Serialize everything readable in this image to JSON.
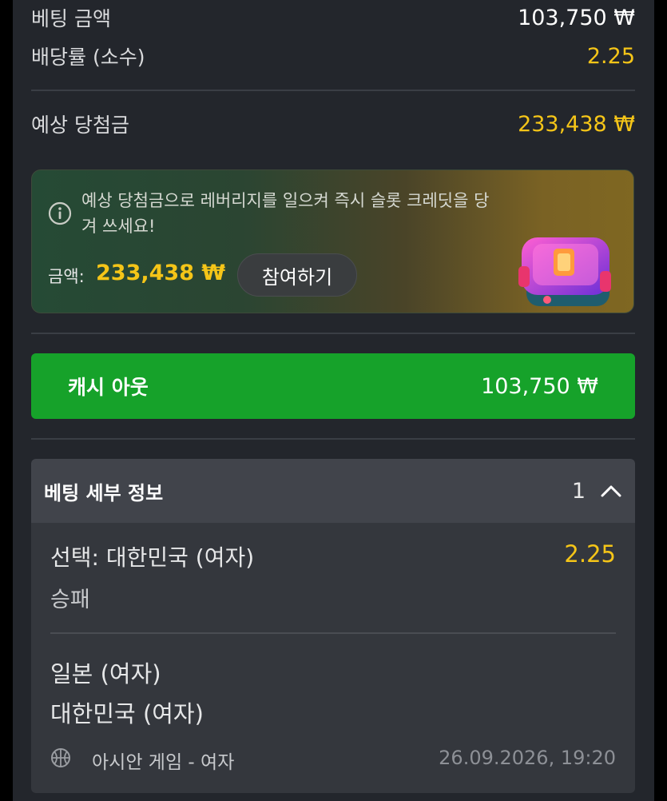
{
  "bet_summary": {
    "stake_label": "베팅 금액",
    "stake_value": "103,750 ₩",
    "odds_label": "배당률 (소수)",
    "odds_value": "2.25",
    "payout_label": "예상 당첨금",
    "payout_value": "233,438 ₩"
  },
  "promo": {
    "message": "예상 당첨금으로 레버리지를 일으켜 즉시 슬롯 크레딧을 당겨 쓰세요!",
    "amount_label": "금액:",
    "amount_value": "233,438 ₩",
    "join_label": "참여하기",
    "icon": "info-icon"
  },
  "cashout": {
    "label": "캐시 아웃",
    "amount": "103,750 ₩",
    "color": "#16a22a"
  },
  "details": {
    "title": "베팅 세부 정보",
    "count": "1",
    "toggle_icon": "chevron-up-icon",
    "selection_label": "선택: 대한민국 (여자)",
    "selection_odds": "2.25",
    "market": "승패",
    "teams": [
      "일본 (여자)",
      "대한민국 (여자)"
    ],
    "sport_icon": "basketball-icon",
    "league": "아시안 게임 - 여자",
    "datetime": "26.09.2026, 19:20"
  },
  "colors": {
    "accent_gold": "#f5c518",
    "panel_bg": "#23262c"
  }
}
